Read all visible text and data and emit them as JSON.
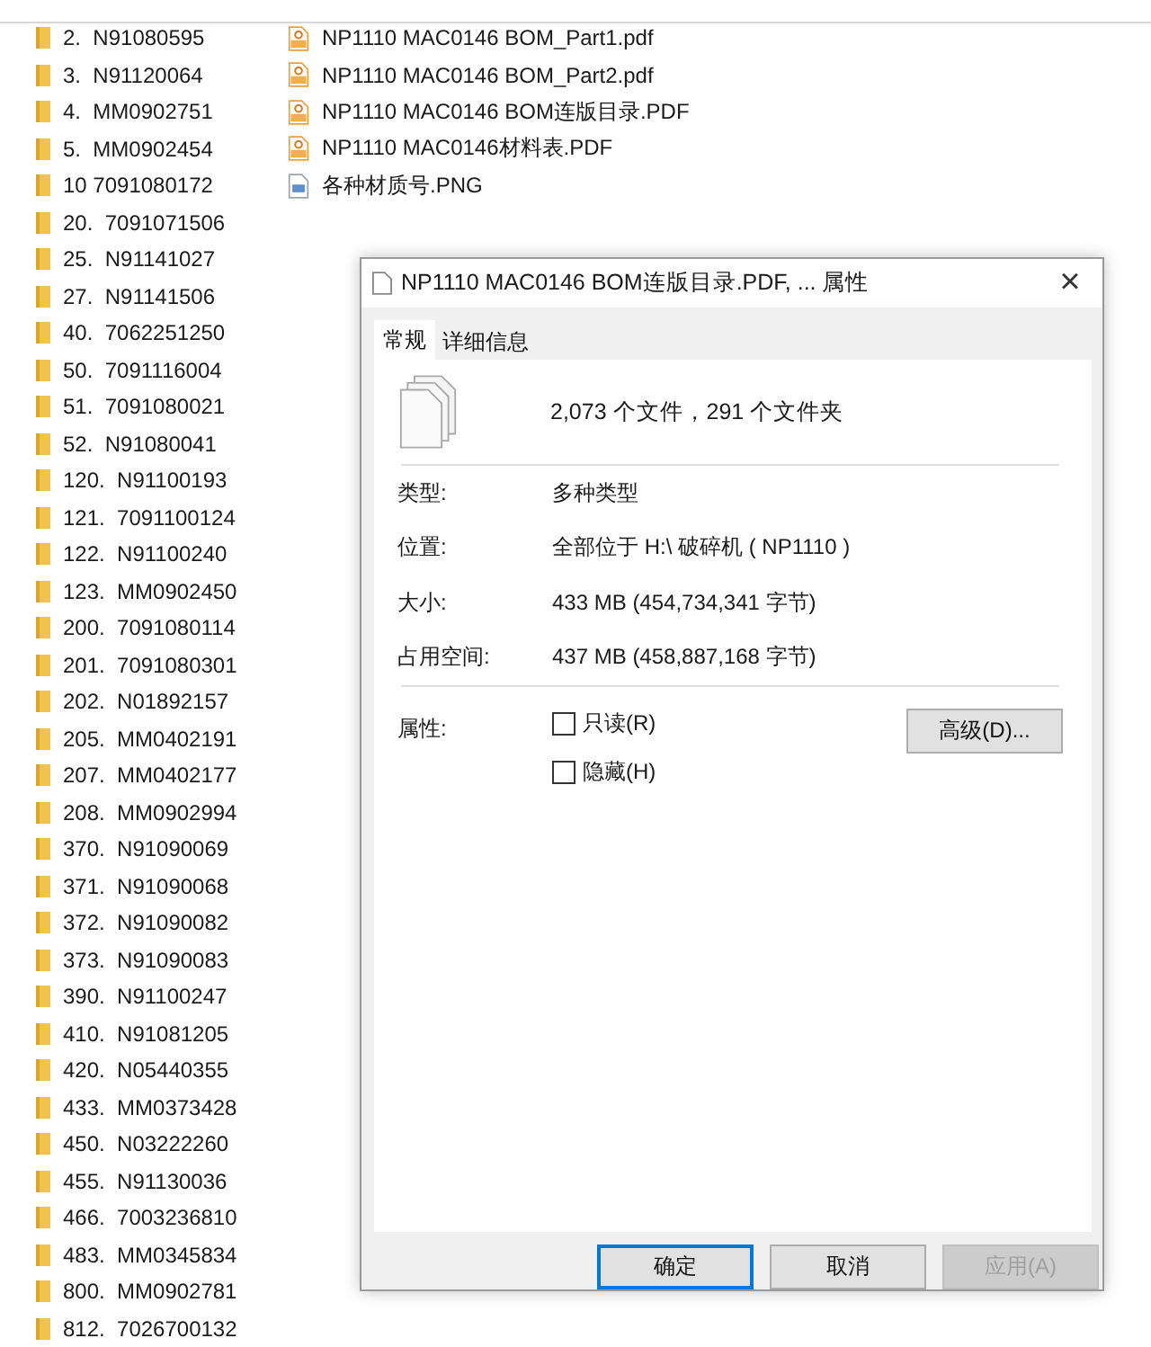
{
  "folders": [
    "2.  N91080595",
    "3.  N91120064",
    "4.  MM0902751",
    "5.  MM0902454",
    "10 7091080172",
    "20.  7091071506",
    "25.  N91141027",
    "27.  N91141506",
    "40.  7062251250",
    "50.  7091116004",
    "51.  7091080021",
    "52.  N91080041",
    "120.  N91100193",
    "121.  7091100124",
    "122.  N91100240",
    "123.  MM0902450",
    "200.  7091080114",
    "201.  7091080301",
    "202.  N01892157",
    "205.  MM0402191",
    "207.  MM0402177",
    "208.  MM0902994",
    "370.  N91090069",
    "371.  N91090068",
    "372.  N91090082",
    "373.  N91090083",
    "390.  N91100247",
    "410.  N91081205",
    "420.  N05440355",
    "433.  MM0373428",
    "450.  N03222260",
    "455.  N91130036",
    "466.  7003236810",
    "483.  MM0345834",
    "800.  MM0902781",
    "812.  7026700132"
  ],
  "files": [
    {
      "name": "NP1110 MAC0146 BOM_Part1.pdf",
      "kind": "pdf"
    },
    {
      "name": "NP1110 MAC0146 BOM_Part2.pdf",
      "kind": "pdf"
    },
    {
      "name": "NP1110 MAC0146 BOM连版目录.PDF",
      "kind": "pdf"
    },
    {
      "name": "NP1110 MAC0146材料表.PDF",
      "kind": "pdf"
    },
    {
      "name": "各种材质号.PNG",
      "kind": "image"
    }
  ],
  "dialog": {
    "title": "NP1110 MAC0146 BOM连版目录.PDF, ... 属性",
    "close": "×",
    "tabs": [
      {
        "label": "常规",
        "selected": true
      },
      {
        "label": "详细信息",
        "selected": false
      }
    ],
    "summary": "2,073 个文件，291 个文件夹",
    "properties": [
      {
        "label": "类型:",
        "value": "多种类型"
      },
      {
        "label": "位置:",
        "value": "全部位于 H:\\ 破碎机 ( NP1110 )"
      },
      {
        "label": "大小:",
        "value": "433 MB (454,734,341 字节)"
      },
      {
        "label": "占用空间:",
        "value": "437 MB (458,887,168 字节)"
      }
    ],
    "attributes_label": "属性:",
    "checkboxes": [
      {
        "label": "只读(R)",
        "checked": false
      },
      {
        "label": "隐藏(H)",
        "checked": false
      }
    ],
    "advanced_button": "高级(D)...",
    "buttons": [
      {
        "label": "确定",
        "default": true,
        "disabled": false
      },
      {
        "label": "取消",
        "default": false,
        "disabled": false
      },
      {
        "label": "应用(A)",
        "default": false,
        "disabled": true
      }
    ]
  }
}
